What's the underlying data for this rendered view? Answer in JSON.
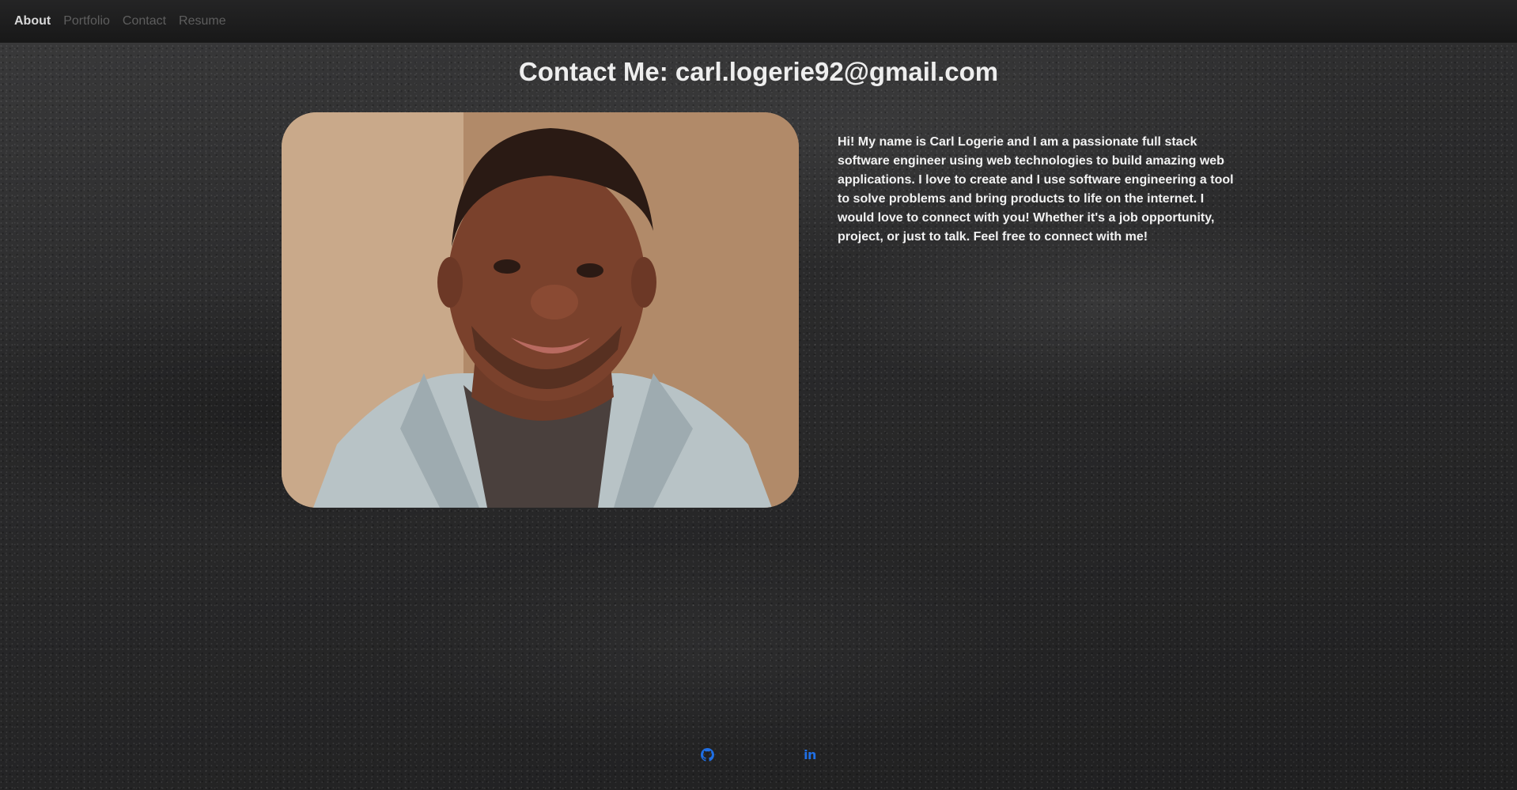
{
  "nav": {
    "items": [
      {
        "label": "About",
        "active": true
      },
      {
        "label": "Portfolio",
        "active": false
      },
      {
        "label": "Contact",
        "active": false
      },
      {
        "label": "Resume",
        "active": false
      }
    ]
  },
  "header": {
    "title": "Contact Me: carl.logerie92@gmail.com"
  },
  "about": {
    "bio": "Hi! My name is Carl Logerie and I am a passionate full stack software engineer using web technologies to build amazing web applications. I love to create and I use software engineering a tool to solve problems and bring products to life on the internet. I would love to connect with you! Whether it's a job opportunity, project, or just to talk. Feel free to connect with me!",
    "photo_icon": "profile-photo"
  },
  "social": {
    "github_icon": "github-icon",
    "linkedin_icon": "linkedin-icon",
    "linkedin_glyph": "in",
    "link_color": "#1f6fe5"
  },
  "colors": {
    "background": "#2a2a2b",
    "navbar": "#1c1c1c",
    "title_text": "#eeeeee",
    "nav_active": "#d8d8d8",
    "nav_inactive": "#5e5e5e"
  }
}
